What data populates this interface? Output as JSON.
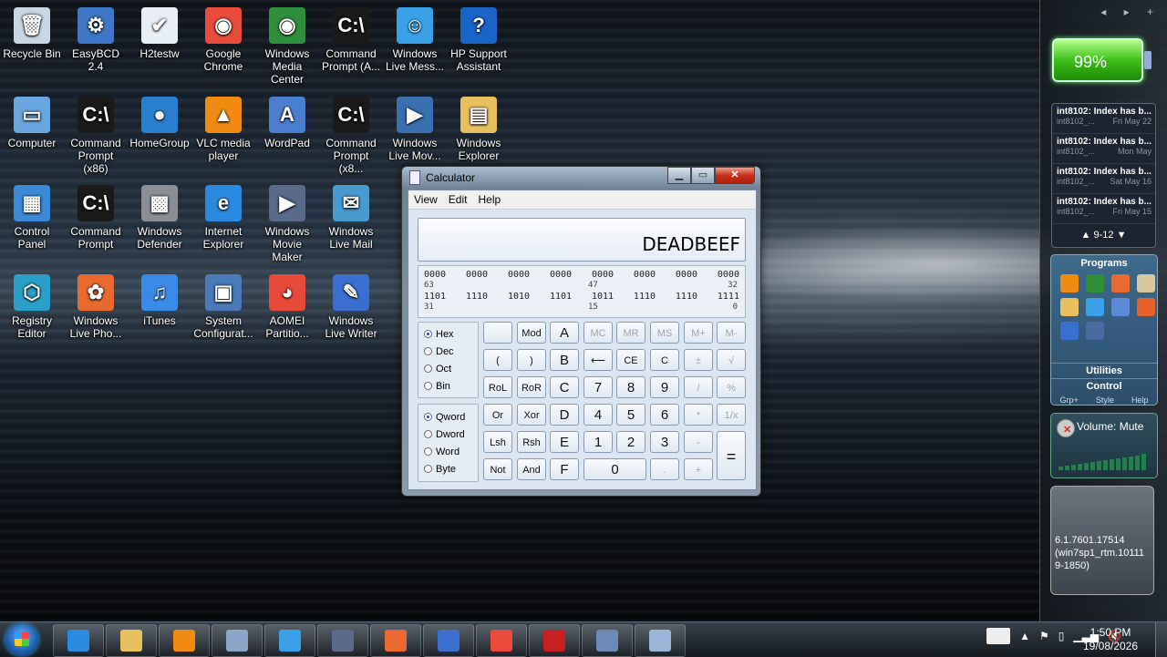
{
  "desktop": {
    "icons": [
      {
        "label": "Recycle Bin",
        "color": "#c9d6e3",
        "glyph": "🗑"
      },
      {
        "label": "EasyBCD 2.4",
        "color": "#3f78c8",
        "glyph": "⚙"
      },
      {
        "label": "H2testw",
        "color": "#e8eef5",
        "glyph": "✔"
      },
      {
        "label": "Google Chrome",
        "color": "#e94b3c",
        "glyph": "◉"
      },
      {
        "label": "Windows Media Center",
        "color": "#2f8f3a",
        "glyph": "◉"
      },
      {
        "label": "Command Prompt (A...",
        "color": "#1a1a1a",
        "glyph": "C:\\"
      },
      {
        "label": "Windows Live Mess...",
        "color": "#3aa0e8",
        "glyph": "☺"
      },
      {
        "label": "HP Support Assistant",
        "color": "#1a63c8",
        "glyph": "?"
      },
      {
        "label": "Computer",
        "color": "#6aa6e0",
        "glyph": "▭"
      },
      {
        "label": "Command Prompt (x86)",
        "color": "#1a1a1a",
        "glyph": "C:\\"
      },
      {
        "label": "HomeGroup",
        "color": "#2a7fd0",
        "glyph": "●"
      },
      {
        "label": "VLC media player",
        "color": "#f08a10",
        "glyph": "▲"
      },
      {
        "label": "WordPad",
        "color": "#4a7fd0",
        "glyph": "A"
      },
      {
        "label": "Command Prompt (x8...",
        "color": "#1a1a1a",
        "glyph": "C:\\"
      },
      {
        "label": "Windows Live Mov...",
        "color": "#3a6fb0",
        "glyph": "▶"
      },
      {
        "label": "Windows Explorer",
        "color": "#e8c060",
        "glyph": "▤"
      },
      {
        "label": "Control Panel",
        "color": "#3a8ad8",
        "glyph": "▦"
      },
      {
        "label": "Command Prompt",
        "color": "#1a1a1a",
        "glyph": "C:\\"
      },
      {
        "label": "Windows Defender",
        "color": "#8a8f96",
        "glyph": "▩"
      },
      {
        "label": "Internet Explorer",
        "color": "#2a8ae0",
        "glyph": "e"
      },
      {
        "label": "Windows Movie Maker",
        "color": "#5a6a8a",
        "glyph": "▶"
      },
      {
        "label": "Windows Live Mail",
        "color": "#4a9ad0",
        "glyph": "✉"
      },
      {
        "label": "Registry Editor",
        "color": "#2aa0c8",
        "glyph": "⬡"
      },
      {
        "label": "Windows Live Pho...",
        "color": "#e86a30",
        "glyph": "✿"
      },
      {
        "label": "iTunes",
        "color": "#3a8ae8",
        "glyph": "♫"
      },
      {
        "label": "System Configurat...",
        "color": "#4a7ab8",
        "glyph": "▣"
      },
      {
        "label": "AOMEI Partitio...",
        "color": "#e84a3a",
        "glyph": "◕"
      },
      {
        "label": "Windows Live Writer",
        "color": "#3a6fd0",
        "glyph": "✎"
      }
    ]
  },
  "calculator": {
    "title": "Calculator",
    "window_buttons": {
      "minimize": "▁",
      "maximize": "▭",
      "close": "✕"
    },
    "menu": [
      "View",
      "Edit",
      "Help"
    ],
    "display_value": "DEADBEEF",
    "bits": {
      "row1": [
        "0000",
        "0000",
        "0000",
        "0000",
        "0000",
        "0000",
        "0000",
        "0000"
      ],
      "row1_labels": [
        "63",
        "47",
        "32"
      ],
      "row2": [
        "1101",
        "1110",
        "1010",
        "1101",
        "1011",
        "1110",
        "1110",
        "1111"
      ],
      "row2_labels": [
        "31",
        "15",
        "0"
      ]
    },
    "base": {
      "options": [
        "Hex",
        "Dec",
        "Oct",
        "Bin"
      ],
      "selected": "Hex"
    },
    "word_size": {
      "options": [
        "Qword",
        "Dword",
        "Word",
        "Byte"
      ],
      "selected": "Qword"
    },
    "keys": {
      "blank": "",
      "mod": "Mod",
      "A": "A",
      "mc": "MC",
      "mr": "MR",
      "ms": "MS",
      "mplus": "M+",
      "mminus": "M-",
      "lparen": "(",
      "rparen": ")",
      "B": "B",
      "back": "⟵",
      "ce": "CE",
      "c": "C",
      "pm": "±",
      "sqrt": "√",
      "rol": "RoL",
      "ror": "RoR",
      "C": "C",
      "k7": "7",
      "k8": "8",
      "k9": "9",
      "div": "/",
      "pct": "%",
      "or": "Or",
      "xor": "Xor",
      "D": "D",
      "k4": "4",
      "k5": "5",
      "k6": "6",
      "mul": "*",
      "recip": "1/x",
      "lsh": "Lsh",
      "rsh": "Rsh",
      "E": "E",
      "k1": "1",
      "k2": "2",
      "k3": "3",
      "sub": "-",
      "eq": "=",
      "not": "Not",
      "and": "And",
      "F": "F",
      "k0": "0",
      "dot": ".",
      "add": "+"
    }
  },
  "sidebar": {
    "nav": "◂ ▸ +",
    "battery": "99%",
    "feed": {
      "items": [
        {
          "title": "int8102: Index has b...",
          "src": "int8102_...",
          "date": "Fri May 22"
        },
        {
          "title": "int8102: Index has b...",
          "src": "int8102_...",
          "date": "Mon May"
        },
        {
          "title": "int8102: Index has b...",
          "src": "int8102_...",
          "date": "Sat May 16"
        },
        {
          "title": "int8102: Index has b...",
          "src": "int8102_...",
          "date": "Fri May 15"
        }
      ],
      "pager": "9-12"
    },
    "programs": {
      "title": "Programs",
      "utilities": "Utilities",
      "control": "Control",
      "footer": [
        "Grp+",
        "Style",
        "Help"
      ]
    },
    "volume": "Volume: Mute",
    "version": "6.1.7601.17514 (win7sp1_rtm.10111 9-1850)"
  },
  "taskbar": {
    "clock_time": "1:50 PM",
    "clock_date": "19/08/2026",
    "apps": [
      "#2a8ae0",
      "#e8c060",
      "#f08a10",
      "#8aa6c8",
      "#3aa0e8",
      "#5a6a8a",
      "#e86a30",
      "#3a6fd0",
      "#e94b3c",
      "#c82020",
      "#6a8ab8",
      "#9ab6d8"
    ]
  }
}
